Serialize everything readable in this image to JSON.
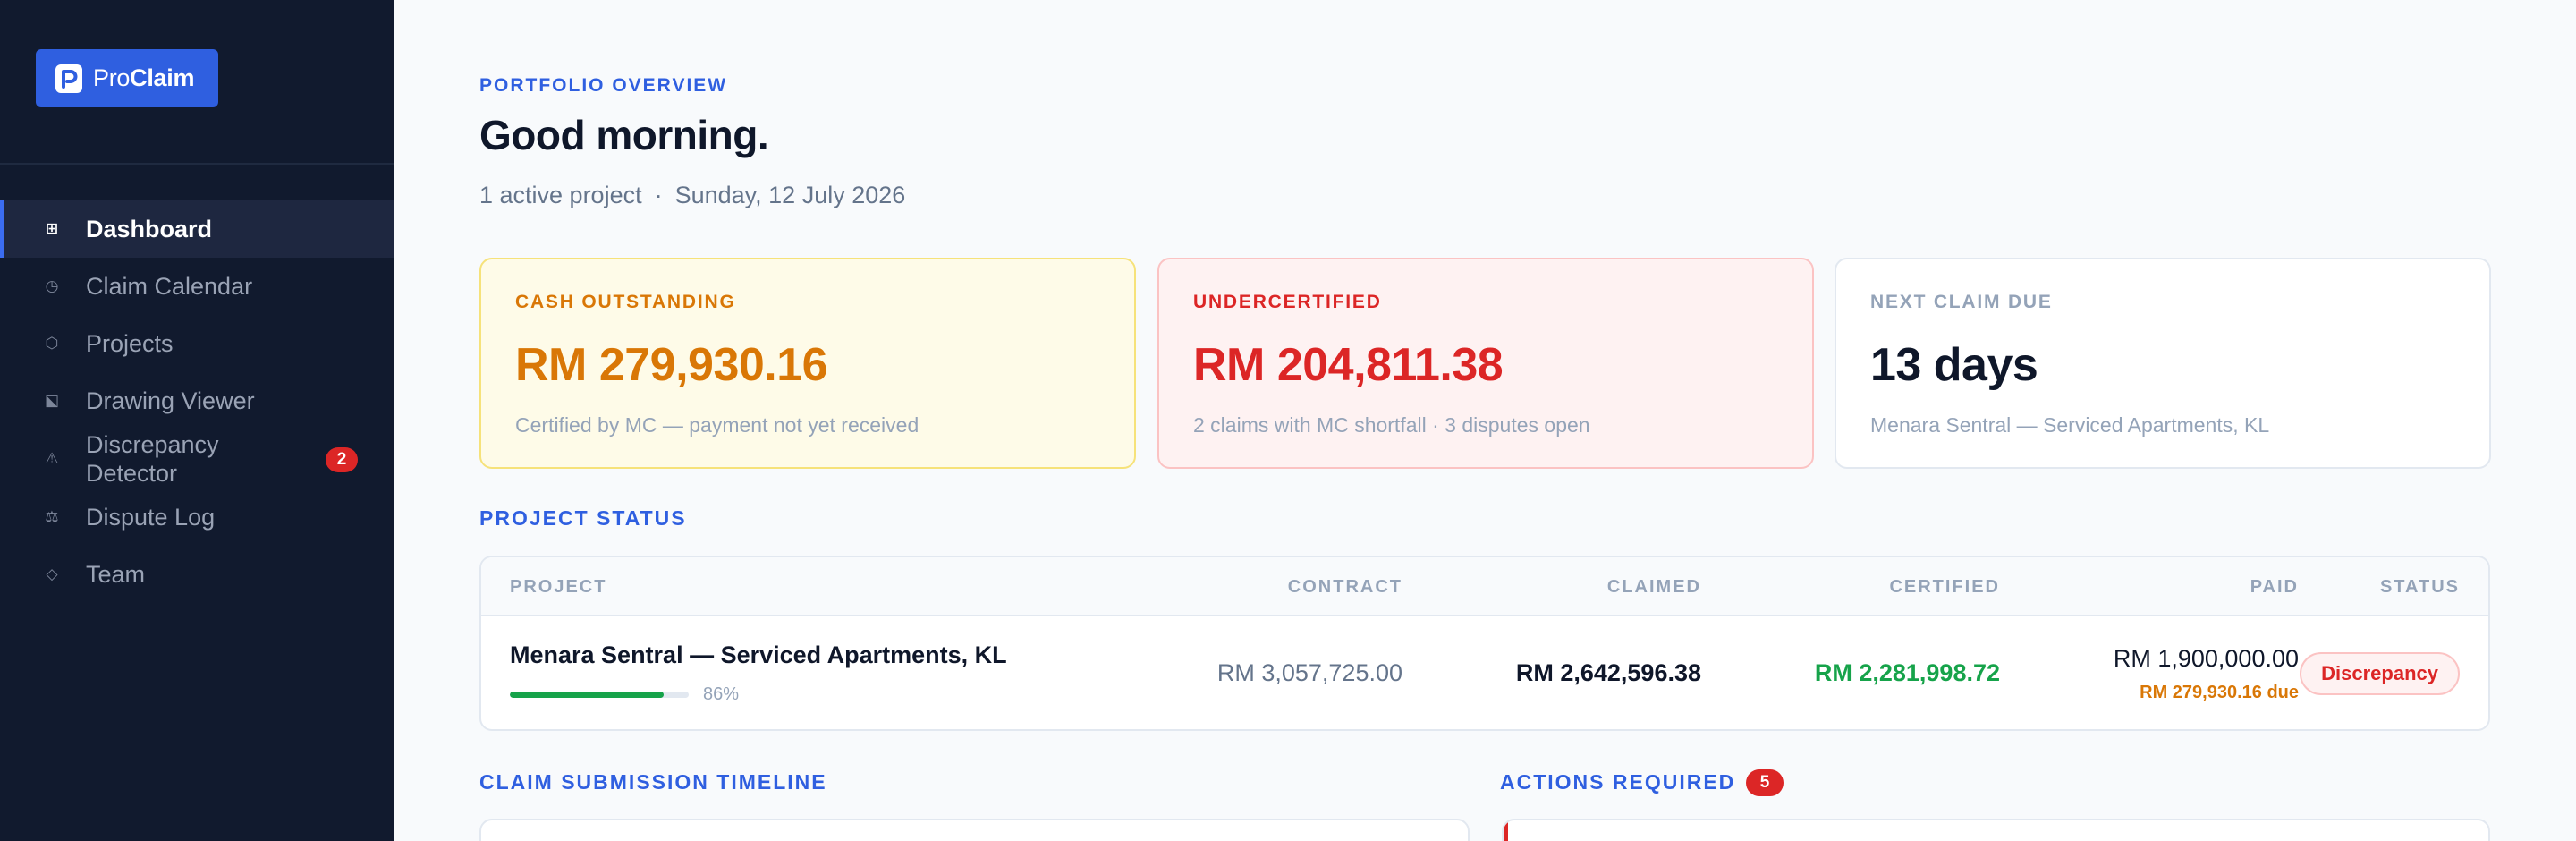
{
  "app": {
    "logo_prefix": "Pro",
    "logo_suffix": "Claim"
  },
  "sidebar": {
    "items": [
      {
        "label": "Dashboard",
        "icon": "grid-icon",
        "active": true
      },
      {
        "label": "Claim Calendar",
        "icon": "clock-icon"
      },
      {
        "label": "Projects",
        "icon": "hexagon-icon"
      },
      {
        "label": "Drawing Viewer",
        "icon": "drawing-icon"
      },
      {
        "label": "Discrepancy Detector",
        "icon": "warning-icon",
        "badge": "2"
      },
      {
        "label": "Dispute Log",
        "icon": "scales-icon"
      },
      {
        "label": "Team",
        "icon": "diamond-icon"
      }
    ]
  },
  "header": {
    "eyebrow": "PORTFOLIO OVERVIEW",
    "greeting": "Good morning.",
    "active_projects": "1 active project",
    "separator": "·",
    "date": "Sunday, 12 July 2026"
  },
  "cards": {
    "cash": {
      "label": "CASH OUTSTANDING",
      "value": "RM 279,930.16",
      "note": "Certified by MC — payment not yet received"
    },
    "undercertified": {
      "label": "UNDERCERTIFIED",
      "value": "RM 204,811.38",
      "note": "2 claims with MC shortfall · 3 disputes open"
    },
    "next_claim": {
      "label": "NEXT CLAIM DUE",
      "value": "13 days",
      "note": "Menara Sentral — Serviced Apartments, KL"
    }
  },
  "project_status": {
    "title": "PROJECT STATUS",
    "columns": {
      "project": "PROJECT",
      "contract": "CONTRACT",
      "claimed": "CLAIMED",
      "certified": "CERTIFIED",
      "paid": "PAID",
      "status": "STATUS"
    },
    "rows": [
      {
        "project": "Menara Sentral — Serviced Apartments, KL",
        "progress": 0.86,
        "progress_label": "86%",
        "contract": "RM 3,057,725.00",
        "claimed": "RM 2,642,596.38",
        "certified": "RM 2,281,998.72",
        "paid": "RM 1,900,000.00",
        "due": "RM 279,930.16 due",
        "status": "Discrepancy"
      }
    ]
  },
  "timeline": {
    "title": "CLAIM SUBMISSION TIMELINE"
  },
  "actions": {
    "title": "ACTIONS REQUIRED",
    "count": "5"
  },
  "colors": {
    "accent": "#2f5fe0",
    "sidebar_bg": "#111a2e",
    "warning": "#d97706",
    "danger": "#dc2626",
    "success": "#16a34a"
  }
}
